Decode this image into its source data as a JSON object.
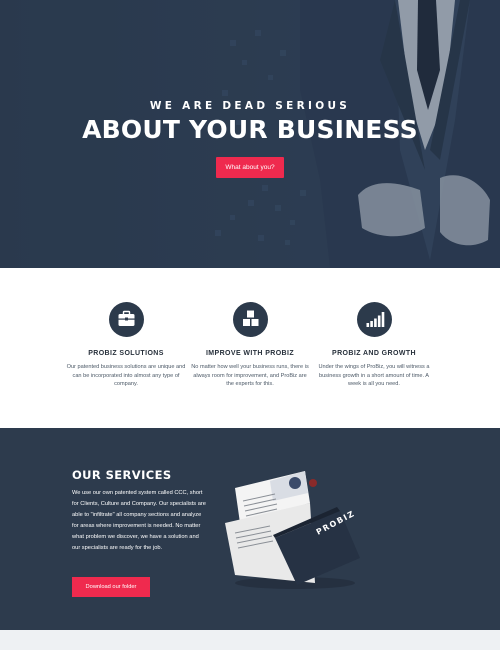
{
  "hero": {
    "kicker": "WE ARE DEAD SERIOUS",
    "title": "ABOUT YOUR BUSINESS",
    "cta": "What about you?"
  },
  "features": [
    {
      "icon": "briefcase-icon",
      "title": "PROBIZ SOLUTIONS",
      "text": "Our patented business solutions are unique and can be incorporated into almost any type of company."
    },
    {
      "icon": "cubes-icon",
      "title": "IMPROVE WITH PROBIZ",
      "text": "No matter how well your business runs, there is always room for improvement, and ProBiz are the experts for this."
    },
    {
      "icon": "bar-chart-icon",
      "title": "PROBIZ AND GROWTH",
      "text": "Under the wings of ProBiz, you will witness a business growth in a short amount of time. A week is all you need."
    }
  ],
  "services": {
    "title": "OUR SERVICES",
    "body": "We use our own patented system called CCC, short for Clients, Culture and Company. Our specialists are able to \"infiltrate\" all company sections and analyze for areas where improvement is needed. No matter what problem we discover, we have a solution and our specialists are ready for the job.",
    "cta": "Download our folder",
    "folder_brand": "PROBIZ"
  },
  "colors": {
    "navy": "#2c3a4b",
    "accent": "#ef2a4e"
  }
}
